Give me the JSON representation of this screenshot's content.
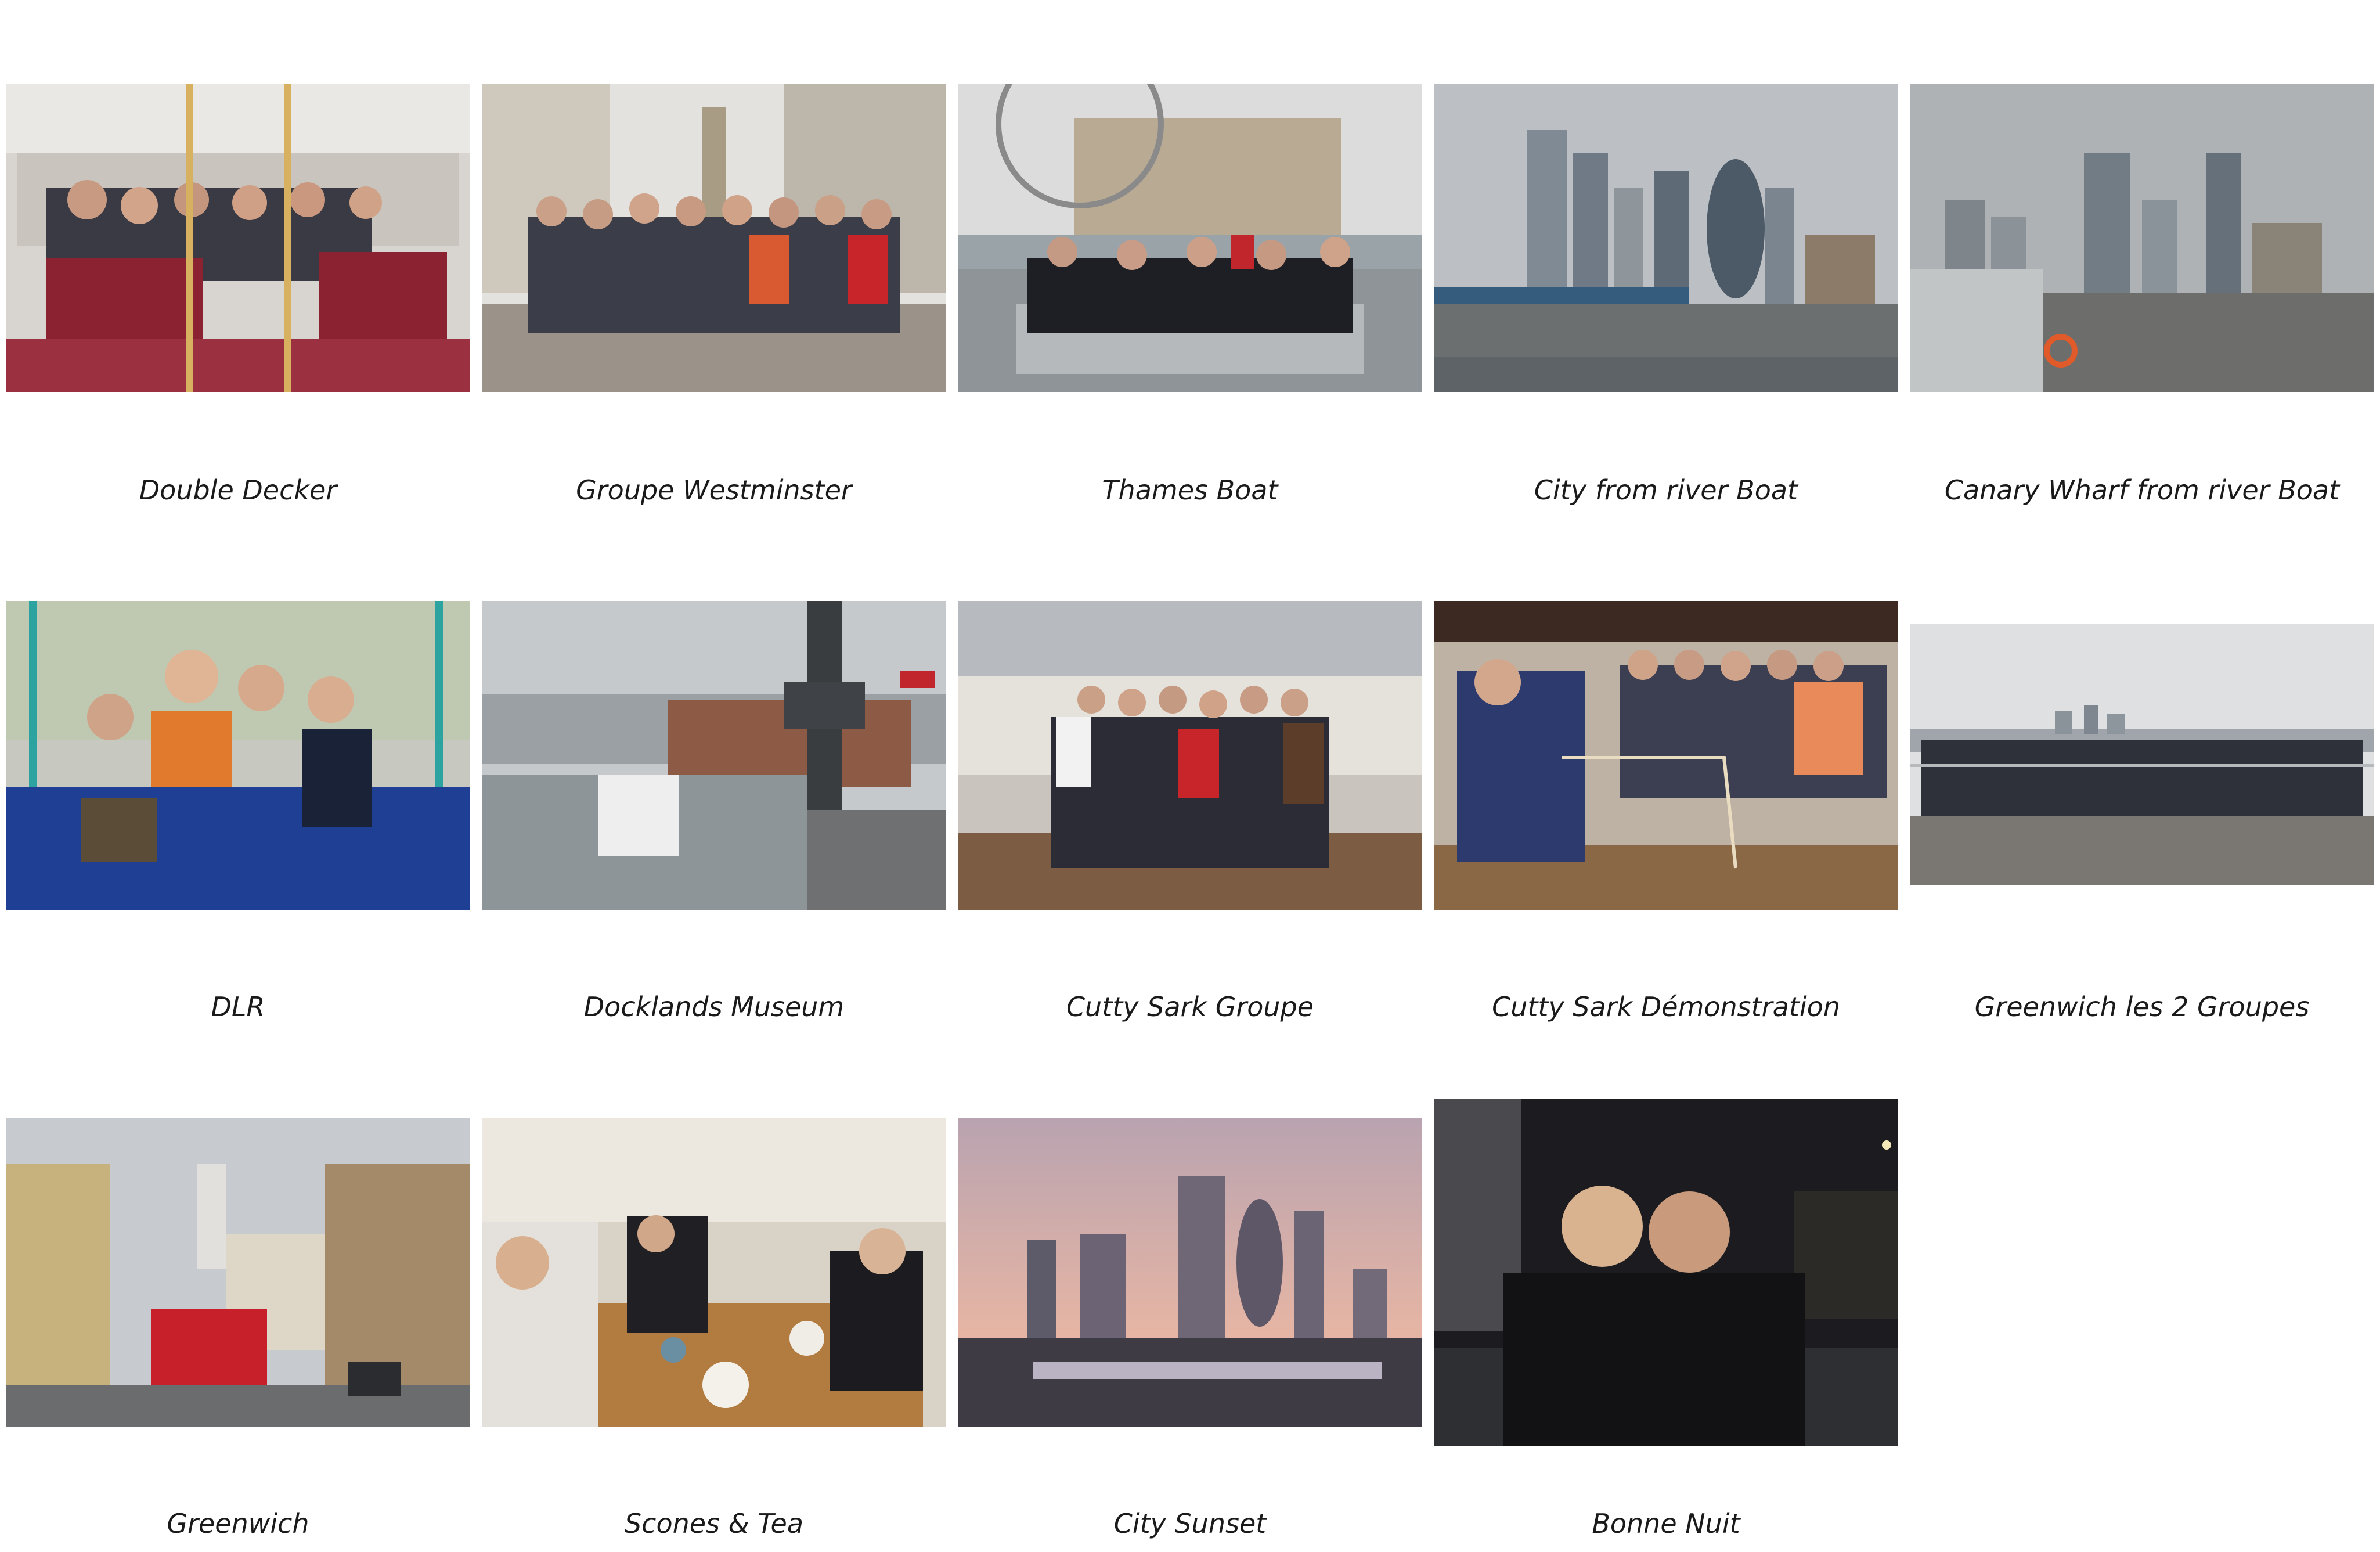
{
  "gallery": {
    "items": [
      {
        "caption": "Double Decker",
        "photo": "double-decker-bus-interior-photo"
      },
      {
        "caption": "Groupe Westminster",
        "photo": "group-westminster-photo"
      },
      {
        "caption": "Thames Boat",
        "photo": "thames-boat-photo"
      },
      {
        "caption": "City from river Boat",
        "photo": "city-skyline-from-river-photo"
      },
      {
        "caption": "Canary Wharf from river Boat",
        "photo": "canary-wharf-from-river-photo"
      },
      {
        "caption": "DLR",
        "photo": "dlr-train-interior-photo"
      },
      {
        "caption": "Docklands Museum",
        "photo": "docklands-museum-photo"
      },
      {
        "caption": "Cutty Sark Groupe",
        "photo": "cutty-sark-group-photo"
      },
      {
        "caption": "Cutty Sark Démonstration",
        "photo": "cutty-sark-demonstration-photo"
      },
      {
        "caption": "Greenwich les 2 Groupes",
        "photo": "greenwich-two-groups-photo"
      },
      {
        "caption": "Greenwich",
        "photo": "greenwich-street-photo"
      },
      {
        "caption": "Scones & Tea",
        "photo": "scones-and-tea-photo"
      },
      {
        "caption": "City Sunset",
        "photo": "city-sunset-photo"
      },
      {
        "caption": "Bonne Nuit",
        "photo": "bonne-nuit-night-photo"
      }
    ]
  },
  "colors": {
    "background": "#ffffff",
    "caption": "#1a1a1a"
  }
}
